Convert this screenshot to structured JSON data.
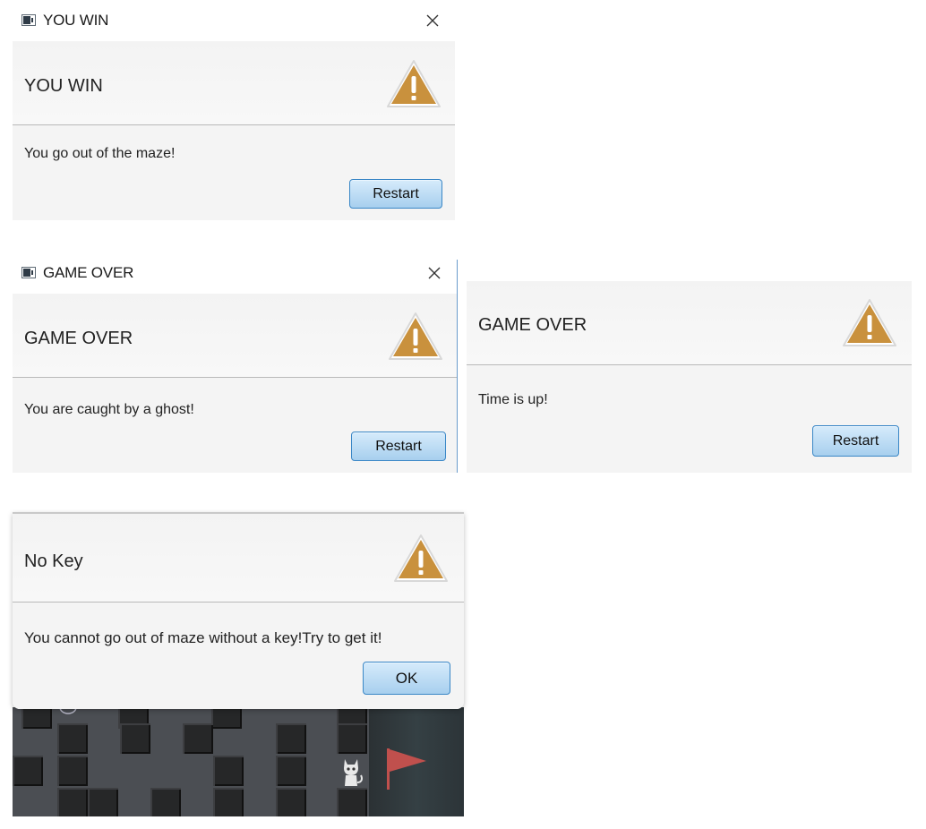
{
  "dialogs": {
    "win": {
      "window_title": "YOU WIN",
      "header": "YOU WIN",
      "message": "You go out of the maze!",
      "button": "Restart"
    },
    "ghost": {
      "window_title": "GAME OVER",
      "header": "GAME OVER",
      "message": "You are caught by a ghost!",
      "button": "Restart"
    },
    "time": {
      "header": "GAME OVER",
      "message": "Time is up!",
      "button": "Restart"
    },
    "nokey": {
      "header": "No Key",
      "message": "You cannot go out of maze without a key!Try to get it!",
      "button": "OK"
    }
  },
  "icons": {
    "warning": "warning-triangle-icon",
    "close": "close-icon",
    "app": "app-window-icon",
    "player": "cat-player-icon",
    "exit": "red-flag-icon"
  },
  "colors": {
    "warning_fill": "#c9913d",
    "button_border": "#3a87c6",
    "flag": "#c0504d"
  }
}
